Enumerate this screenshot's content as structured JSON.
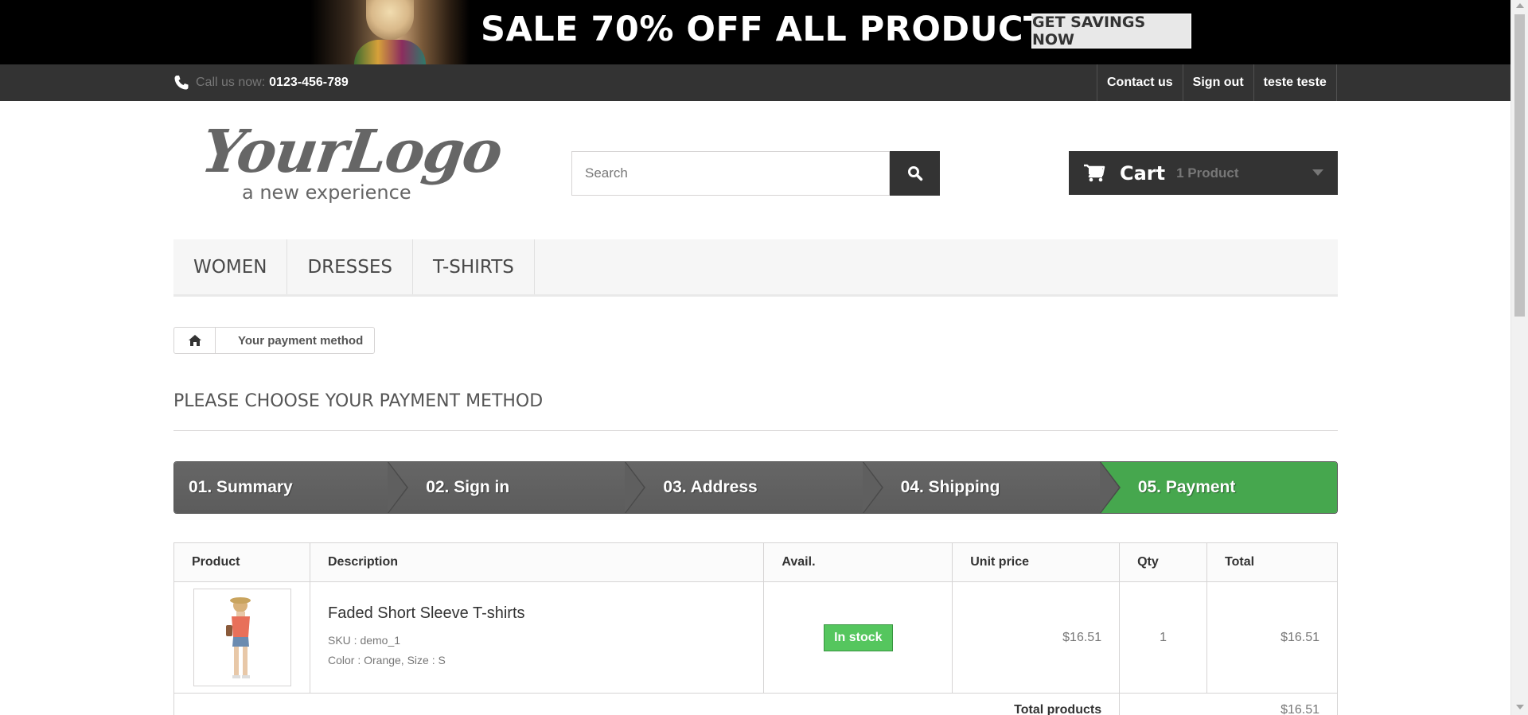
{
  "banner": {
    "headline": "SALE 70% OFF ALL PRODUCTS",
    "cta_label": "GET SAVINGS NOW"
  },
  "topnav": {
    "call_label": "Call us now:",
    "phone": "0123-456-789",
    "links": [
      "Contact us",
      "Sign out",
      "teste teste"
    ]
  },
  "header": {
    "logo_script": "YourLogo",
    "logo_tagline": "a new experience",
    "search_placeholder": "Search",
    "search_value": "",
    "cart_label": "Cart",
    "cart_count": "1 Product"
  },
  "menu": {
    "items": [
      "WOMEN",
      "DRESSES",
      "T-SHIRTS"
    ]
  },
  "breadcrumb": {
    "current": "Your payment method"
  },
  "page": {
    "title": "PLEASE CHOOSE YOUR PAYMENT METHOD"
  },
  "steps": [
    {
      "label": "01. Summary",
      "active": false
    },
    {
      "label": "02. Sign in",
      "active": false
    },
    {
      "label": "03. Address",
      "active": false
    },
    {
      "label": "04. Shipping",
      "active": false
    },
    {
      "label": "05. Payment",
      "active": true
    }
  ],
  "cart_table": {
    "headers": [
      "Product",
      "Description",
      "Avail.",
      "Unit price",
      "Qty",
      "Total"
    ],
    "rows": [
      {
        "name": "Faded Short Sleeve T-shirts",
        "sku": "SKU : demo_1",
        "attributes": "Color : Orange, Size : S",
        "availability": "In stock",
        "unit_price": "$16.51",
        "qty": "1",
        "total": "$16.51"
      }
    ],
    "total_products_label": "Total products",
    "total_products_value": "$16.51"
  },
  "colors": {
    "accent_green": "#46a74e",
    "dark": "#333333",
    "stock_green": "#55c65e"
  }
}
